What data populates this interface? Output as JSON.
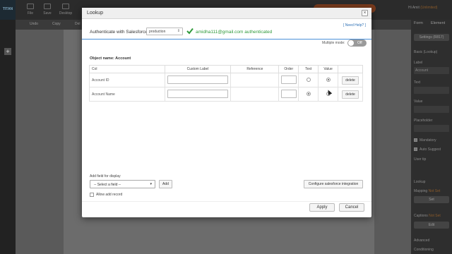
{
  "app": {
    "logo": "TITAN",
    "toolbar": [
      "File",
      "Save",
      "Desktop"
    ],
    "toolbar2": [
      "Undo",
      "Copy",
      "Del"
    ],
    "user_greeting": "Hi Amit",
    "user_plan": "(Unlimited)"
  },
  "right_panel": {
    "tabs": [
      "Form",
      "Element"
    ],
    "settings_button": "Settings (R817)",
    "section_title": "Basic (Lookup)",
    "label_caption": "Label",
    "label_value": "Account",
    "text_caption": "Text",
    "value_caption": "Value",
    "placeholder_caption": "Placeholder",
    "mandatory": "Mandatory",
    "auto_suggest": "Auto Suggest",
    "user_tip": "User tip",
    "lookup_caption": "Lookup",
    "mapping_caption": "Mapping",
    "mapping_status": "Not Set",
    "set_button": "Set",
    "captions_caption": "Captions",
    "captions_status": "Not Set",
    "edit_button": "Edit",
    "advanced": "Advanced",
    "conditioning": "Conditioning"
  },
  "modal": {
    "title": "Lookup",
    "close": "×",
    "need_help": "[ Need Help? ]",
    "auth_label": "Authenticate with Salesforce",
    "environment": "production",
    "auth_status": "amidha111@gmail.com authenticated",
    "multiple_mode_label": "Multiple mode:",
    "multiple_mode_value": "Off",
    "object_name": "Object name: Account",
    "columns": [
      "Col",
      "Custom Label",
      "Reference",
      "Order",
      "Text",
      "Value",
      ""
    ],
    "rows": [
      {
        "col": "Account ID",
        "text_selected": false,
        "value_selected": true,
        "delete": "delete"
      },
      {
        "col": "Account Name",
        "text_selected": true,
        "value_selected": false,
        "delete": "delete"
      }
    ],
    "add_field_label": "Add field for display",
    "select_field_placeholder": "-- Select a field --",
    "add_button": "Add",
    "configure_button": "Configure salesforce integration",
    "allow_add_record": "Allow add record",
    "apply_button": "Apply",
    "cancel_button": "Cancel"
  },
  "colors": {
    "accent_blue": "#4a90d9",
    "success_green": "#2f9a3b",
    "link_blue": "#2c6fb5"
  }
}
